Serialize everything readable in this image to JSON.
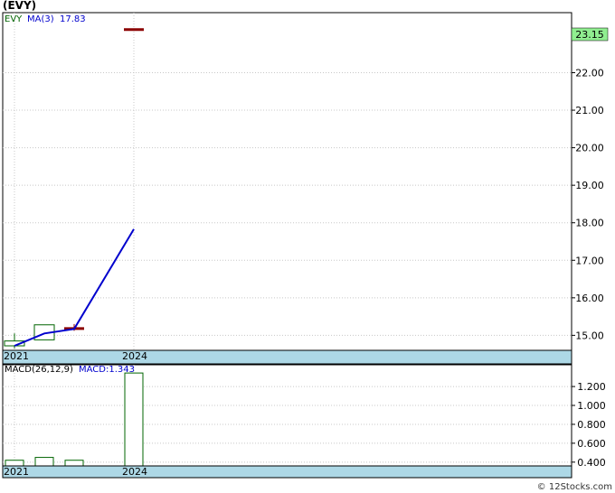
{
  "title": "(EVY)",
  "copyright": "© 12Stocks.com",
  "colors": {
    "background": "#ffffff",
    "grid": "#c8c8c8",
    "border": "#000000",
    "time_axis_band": "#add8e6",
    "candle_up": "#006400",
    "candle_down": "#8b0000",
    "ma_line": "#0000cd",
    "price_box": "#90ee90",
    "macd_bar": "#006400"
  },
  "chart_data": [
    {
      "type": "candlestick",
      "legend": {
        "ticker": "EVY",
        "ma_label": "MA(3)",
        "ma_value": "17.83"
      },
      "x_labels": [
        "2021",
        "2024"
      ],
      "y_ticks": [
        "15.00",
        "16.00",
        "17.00",
        "18.00",
        "19.00",
        "20.00",
        "21.00",
        "22.00"
      ],
      "ylim": [
        14.6,
        23.6
      ],
      "last_price": "23.15",
      "candles": [
        {
          "period": "2021",
          "open": 14.72,
          "high": 15.05,
          "low": 14.65,
          "close": 14.85,
          "direction": "up"
        },
        {
          "period": "2022",
          "open": 14.88,
          "high": 15.28,
          "low": 14.88,
          "close": 15.28,
          "direction": "up"
        },
        {
          "period": "2023",
          "open": 15.18,
          "high": 15.3,
          "low": 15.12,
          "close": 15.18,
          "direction": "down"
        },
        {
          "period": "2024",
          "open": 23.15,
          "high": 23.15,
          "low": 23.15,
          "close": 23.15,
          "direction": "down"
        }
      ],
      "ma3": [
        14.72,
        15.05,
        15.17,
        17.83
      ]
    },
    {
      "type": "bar",
      "legend": {
        "indicator": "MACD(26,12,9)",
        "macd_label": "MACD:1.343"
      },
      "x_labels": [
        "2021",
        "2024"
      ],
      "y_ticks": [
        "0.400",
        "0.600",
        "0.800",
        "1.000",
        "1.200"
      ],
      "ylim": [
        0.36,
        1.43
      ],
      "categories": [
        "2021",
        "2022",
        "2023",
        "2024"
      ],
      "values": [
        0.42,
        0.45,
        0.42,
        1.343
      ]
    }
  ]
}
